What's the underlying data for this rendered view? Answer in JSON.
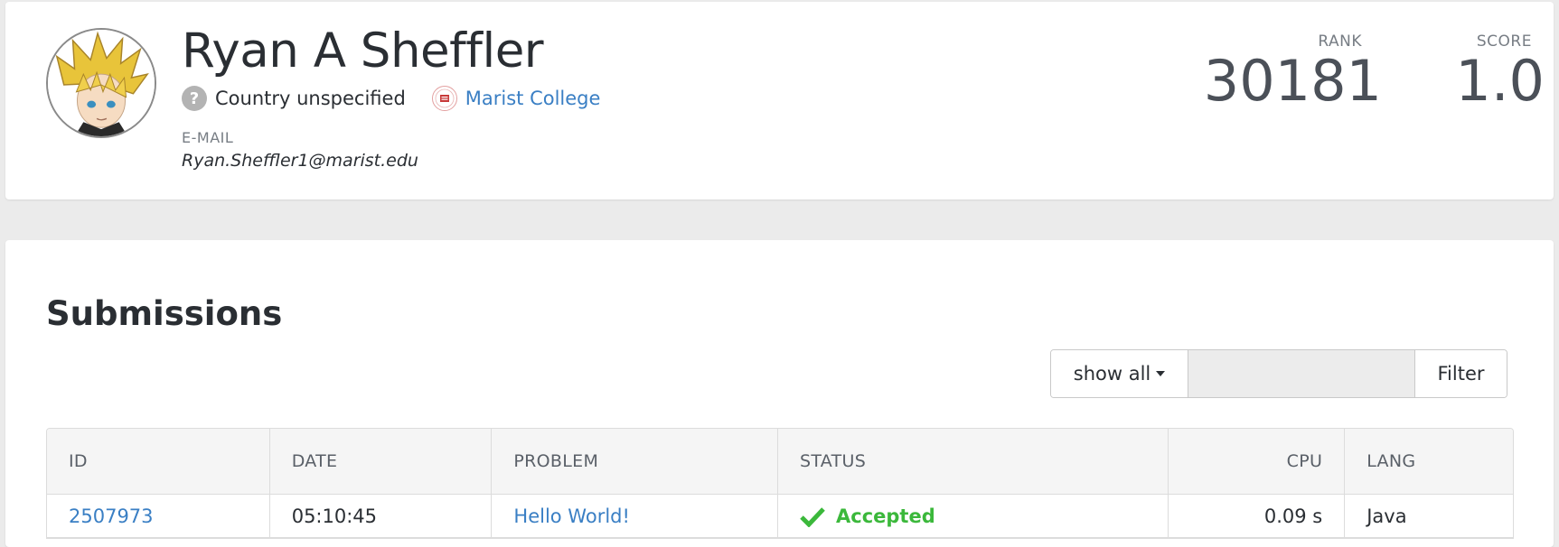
{
  "profile": {
    "name": "Ryan A Sheffler",
    "country": "Country unspecified",
    "university": "Marist College",
    "email_label": "E-MAIL",
    "email": "Ryan.Sheffler1@marist.edu",
    "rank_label": "RANK",
    "rank_value": "30181",
    "score_label": "SCORE",
    "score_value": "1.0",
    "avatar_icon": "avatar-image",
    "country_icon": "question-icon"
  },
  "submissions": {
    "title": "Submissions",
    "filter": {
      "dropdown_label": "show all",
      "input_value": "",
      "button_label": "Filter"
    },
    "columns": [
      "ID",
      "DATE",
      "PROBLEM",
      "STATUS",
      "CPU",
      "LANG"
    ],
    "rows": [
      {
        "id": "2507973",
        "date": "05:10:45",
        "problem": "Hello World!",
        "status": "Accepted",
        "cpu": "0.09 s",
        "lang": "Java"
      }
    ]
  },
  "colors": {
    "link": "#3a7fc4",
    "accepted": "#3bb83b",
    "background": "#ebebeb",
    "card": "#ffffff"
  }
}
